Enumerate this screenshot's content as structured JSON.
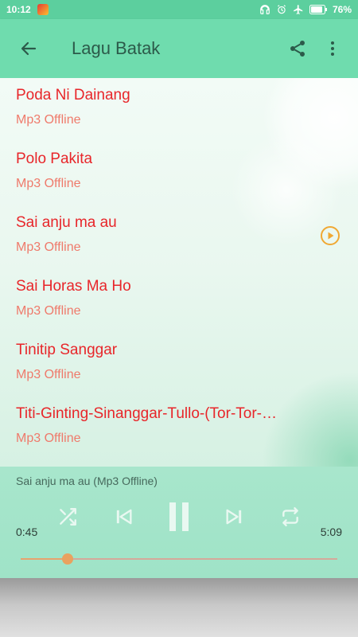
{
  "status_bar": {
    "time": "10:12",
    "battery": "76%"
  },
  "app_bar": {
    "title": "Lagu Batak",
    "back_icon": "arrow-back-icon",
    "share_icon": "share-icon",
    "more_icon": "more-vert-icon"
  },
  "songs": [
    {
      "title": "Poda Ni Dainang",
      "subtitle": "Mp3 Offline"
    },
    {
      "title": "Polo Pakita",
      "subtitle": "Mp3 Offline"
    },
    {
      "title": "Sai anju ma au",
      "subtitle": "Mp3 Offline"
    },
    {
      "title": "Sai Horas Ma Ho",
      "subtitle": "Mp3 Offline"
    },
    {
      "title": "Tinitip Sanggar",
      "subtitle": "Mp3 Offline"
    },
    {
      "title": "Titi-Ginting-Sinanggar-Tullo-(Tor-Tor-…",
      "subtitle": "Mp3 Offline"
    }
  ],
  "player": {
    "now_playing": "Sai anju ma au (Mp3 Offline)",
    "elapsed": "0:45",
    "total": "5:09",
    "progress": 0.149,
    "state": "playing"
  },
  "colors": {
    "app_bar": "#6fdcae",
    "song_title": "#e8262a",
    "song_subtitle": "#ef7a6b",
    "player_bg": "#a8e6cc",
    "accent": "#e9a25f"
  }
}
